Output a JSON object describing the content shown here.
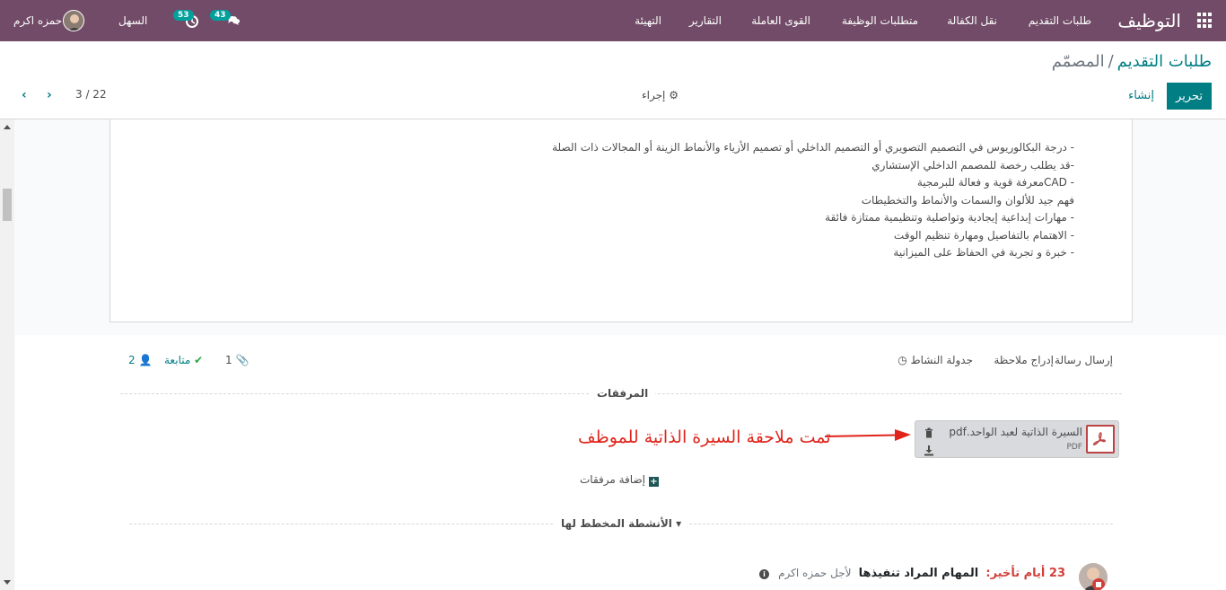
{
  "topbar": {
    "app_title": "التوظيف",
    "menu": [
      {
        "label": "طلبات التقديم"
      },
      {
        "label": "نقل الكفالة"
      },
      {
        "label": "متطلبات الوظيفة"
      },
      {
        "label": "القوى العاملة"
      },
      {
        "label": "التقارير"
      },
      {
        "label": "التهيئة"
      }
    ],
    "company": "السهل",
    "activity_count": "53",
    "message_count": "43",
    "user_name": "حمزه اكرم"
  },
  "control_panel": {
    "breadcrumb_parent": "طلبات التقديم",
    "breadcrumb_sep": "/",
    "breadcrumb_current": "المصمّم",
    "edit_label": "تحرير",
    "create_label": "إنشاء",
    "action_label": "إجراء",
    "pager": "3 / 22"
  },
  "requirements": [
    "- درجة البكالوريوس في التصميم التصويري أو التصميم الداخلي أو تصميم الأزياء والأنماط الزينة أو المجالات ذات الصلة",
    "-قد يطلب رخصة للمصمم الداخلي الإستشاري",
    "- CADمعرفة قوية و فعالة للبرمجية",
    "فهم جيد للألوان والسمات والأنماط والتخطيطات",
    "- مهارات إبداعية إيجادية وتواصلية وتنظيمية ممتازة فائقة",
    "- الاهتمام بالتفاصيل ومهارة تنظيم الوقت",
    "- خبرة و تجربة في الحفاظ على الميزانية"
  ],
  "chatter": {
    "send_message": "إرسال رسالة",
    "log_note": "إدراج ملاحظة",
    "schedule_activity": "جدولة النشاط",
    "attachments_count": "1",
    "follow_label": "متابعة",
    "followers_count": "2",
    "attachments_title": "المرفقات",
    "attachment": {
      "name": "السيرة الذاتية لعبد الواحد.pdf",
      "type": "PDF"
    },
    "annotation": "تمت ملاحقة السيرة الذاتية للموظف",
    "add_attachments": "إضافة مرفقات",
    "planned_title": "الأنشطة المخطط لها",
    "activity": {
      "late": "23 أيام تأخير:",
      "title": "المهام المراد تنفيذها",
      "for": "لأجل حمزه اكرم"
    }
  },
  "colors": {
    "topbar": "#714b67",
    "primary": "#017e84",
    "badge": "#00a09d",
    "annotation": "#e0241b",
    "late": "#d23f3a"
  }
}
